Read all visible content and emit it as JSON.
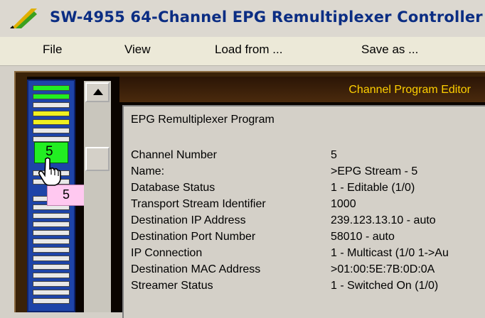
{
  "window": {
    "title": "SW-4955  64-Channel  EPG Remultiplexer  Controller"
  },
  "menu": {
    "items": [
      {
        "label": "File"
      },
      {
        "label": "View"
      },
      {
        "label": "Load from ..."
      },
      {
        "label": "Save as ..."
      }
    ]
  },
  "channel_strip": {
    "selected_channel": "5",
    "tooltip": "5",
    "bar_colors": {
      "active": "#22ee22",
      "warning": "#f0f020",
      "idle": "#e8e8e8"
    }
  },
  "editor": {
    "header": "Channel Program Editor",
    "program_title": "EPG Remultiplexer Program",
    "fields": [
      {
        "label": "Channel Number",
        "value": "5"
      },
      {
        "label": "Name:",
        "value": ">EPG Stream - 5"
      },
      {
        "label": "Database Status",
        "value": "1 - Editable (1/0)"
      },
      {
        "label": "Transport Stream Identifier",
        "value": "1000"
      },
      {
        "label": "Destination IP Address",
        "value": "239.123.13.10 - auto"
      },
      {
        "label": "Destination Port Number",
        "value": "58010 - auto"
      },
      {
        "label": "IP Connection",
        "value": "1 - Multicast (1/0 1->Au"
      },
      {
        "label": "Destination MAC Address",
        "value": ">01:00:5E:7B:0D:0A"
      },
      {
        "label": "Streamer Status",
        "value": "1 - Switched On  (1/0)"
      }
    ]
  },
  "icons": {
    "app_logo": "app-logo-icon",
    "scroll_up": "arrow-up-icon",
    "cursor": "hand-pointer-icon"
  }
}
